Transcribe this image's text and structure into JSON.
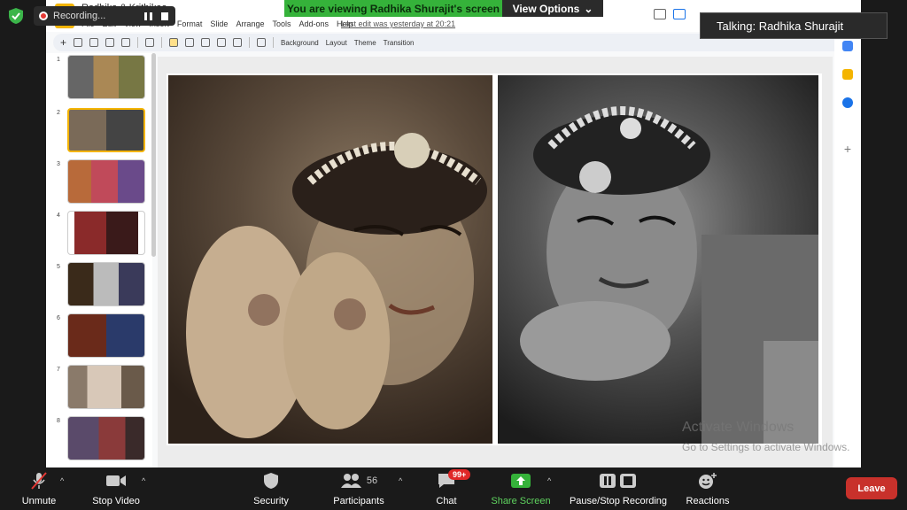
{
  "recording": {
    "label": "Recording..."
  },
  "banner": {
    "viewing": "You are viewing Radhika Shurajit's screen",
    "view_options": "View Options"
  },
  "talking": {
    "label": "Talking: Radhika Shurajit"
  },
  "slides_app": {
    "doc_title": "Radhika & Krithikaa",
    "menu": [
      "File",
      "Edit",
      "View",
      "Insert",
      "Format",
      "Slide",
      "Arrange",
      "Tools",
      "Add-ons",
      "Help"
    ],
    "last_edit": "Last edit was yesterday at 20:21",
    "toolbar": {
      "background": "Background",
      "layout": "Layout",
      "theme": "Theme",
      "transition": "Transition"
    },
    "thumbnails": [
      {
        "num": "1"
      },
      {
        "num": "2"
      },
      {
        "num": "3"
      },
      {
        "num": "4"
      },
      {
        "num": "5"
      },
      {
        "num": "6"
      },
      {
        "num": "7"
      },
      {
        "num": "8"
      }
    ],
    "active_slide": 2
  },
  "watermark": {
    "line1": "Activate Windows",
    "line2": "Go to Settings to activate Windows."
  },
  "zoom_bar": {
    "unmute": "Unmute",
    "stop_video": "Stop Video",
    "security": "Security",
    "participants": "Participants",
    "participants_count": "56",
    "chat": "Chat",
    "chat_badge": "99+",
    "share_screen": "Share Screen",
    "recording": "Pause/Stop Recording",
    "reactions": "Reactions",
    "leave": "Leave"
  },
  "colors": {
    "share_green": "#35b23a",
    "leave_red": "#c8312b",
    "active_thumb": "#f4b400"
  }
}
